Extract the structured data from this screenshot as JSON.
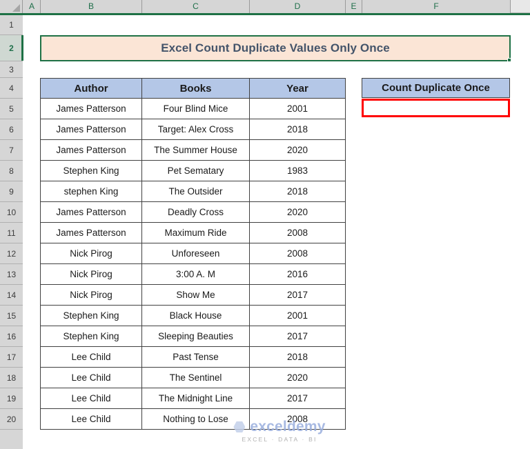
{
  "spreadsheet": {
    "column_headers": [
      "A",
      "B",
      "C",
      "D",
      "E",
      "F"
    ],
    "row_headers": [
      "1",
      "2",
      "3",
      "4",
      "5",
      "6",
      "7",
      "8",
      "9",
      "10",
      "11",
      "12",
      "13",
      "14",
      "15",
      "16",
      "17",
      "18",
      "19",
      "20"
    ],
    "selected_row": "2",
    "colors": {
      "header_fill": "#B4C7E7",
      "title_fill": "#FBE5D6",
      "title_text": "#44546A",
      "selection_green": "#1E7145",
      "result_border_red": "#FF0000",
      "col_header_text": "#1F6F4A"
    }
  },
  "title": {
    "text": "Excel Count Duplicate Values Only Once"
  },
  "table": {
    "headers": [
      "Author",
      "Books",
      "Year"
    ],
    "rows": [
      [
        "James Patterson",
        "Four Blind Mice",
        "2001"
      ],
      [
        "James Patterson",
        "Target: Alex Cross",
        "2018"
      ],
      [
        "James Patterson",
        "The Summer House",
        "2020"
      ],
      [
        "Stephen King",
        "Pet Sematary",
        "1983"
      ],
      [
        "stephen King",
        "The Outsider",
        "2018"
      ],
      [
        "James Patterson",
        "Deadly Cross",
        "2020"
      ],
      [
        "James Patterson",
        "Maximum Ride",
        "2008"
      ],
      [
        "Nick Pirog",
        "Unforeseen",
        "2008"
      ],
      [
        "Nick Pirog",
        "3:00 A. M",
        "2016"
      ],
      [
        "Nick Pirog",
        "Show Me",
        "2017"
      ],
      [
        "Stephen King",
        "Black House",
        "2001"
      ],
      [
        "Stephen King",
        "Sleeping Beauties",
        "2017"
      ],
      [
        "Lee Child",
        "Past Tense",
        "2018"
      ],
      [
        "Lee Child",
        "The Sentinel",
        "2020"
      ],
      [
        "Lee Child",
        "The Midnight Line",
        "2017"
      ],
      [
        "Lee Child",
        "Nothing to Lose",
        "2008"
      ]
    ]
  },
  "result": {
    "header": "Count Duplicate Once",
    "value": ""
  },
  "watermark": {
    "name": "exceldemy",
    "tagline": "EXCEL · DATA · BI",
    "logo_icon": "hexagon-logo-icon"
  }
}
